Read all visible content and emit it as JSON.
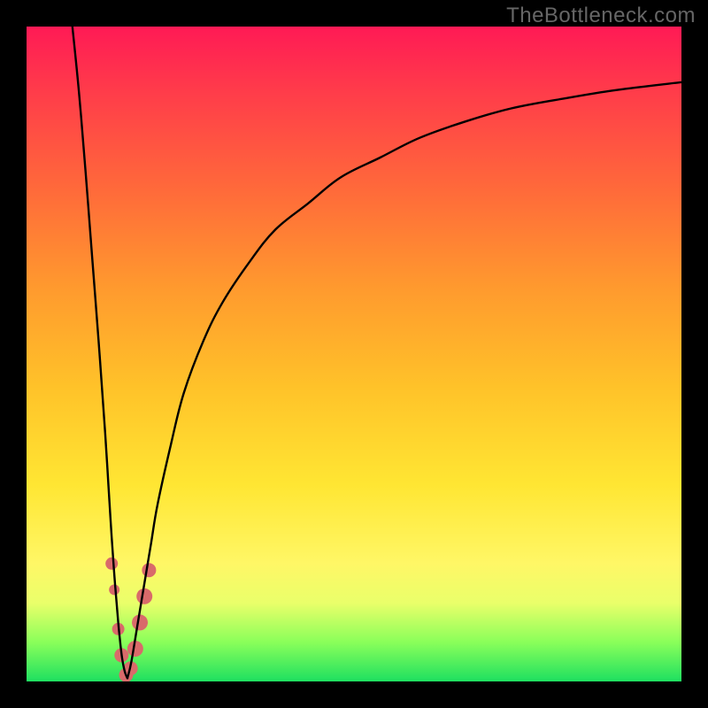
{
  "watermark": "TheBottleneck.com",
  "chart_data": {
    "type": "line",
    "title": "",
    "xlabel": "",
    "ylabel": "",
    "xlim": [
      0,
      100
    ],
    "ylim": [
      0,
      100
    ],
    "series": [
      {
        "name": "left-branch",
        "x": [
          7,
          8,
          9,
          10,
          11,
          12,
          12.5,
          13,
          13.5,
          14,
          14.3,
          14.6,
          15,
          15.4
        ],
        "y": [
          100,
          90,
          78,
          65,
          52,
          38,
          30,
          22,
          15,
          9,
          6,
          3.5,
          1.5,
          0.5
        ]
      },
      {
        "name": "right-branch",
        "x": [
          15.4,
          16,
          17,
          18,
          19,
          20,
          22,
          24,
          27,
          30,
          34,
          38,
          43,
          48,
          54,
          60,
          67,
          74,
          82,
          90,
          100
        ],
        "y": [
          0.5,
          3,
          9,
          15,
          21,
          27,
          36,
          44,
          52,
          58,
          64,
          69,
          73,
          77,
          80,
          83,
          85.5,
          87.5,
          89,
          90.3,
          91.5
        ]
      }
    ],
    "markers": {
      "name": "highlight-dots",
      "color": "#d96a6a",
      "points": [
        {
          "x": 13.0,
          "y": 18,
          "r": 7
        },
        {
          "x": 13.4,
          "y": 14,
          "r": 6
        },
        {
          "x": 14.0,
          "y": 8,
          "r": 7
        },
        {
          "x": 14.5,
          "y": 4,
          "r": 8
        },
        {
          "x": 15.2,
          "y": 1,
          "r": 8
        },
        {
          "x": 15.9,
          "y": 2,
          "r": 8
        },
        {
          "x": 16.6,
          "y": 5,
          "r": 9
        },
        {
          "x": 17.3,
          "y": 9,
          "r": 9
        },
        {
          "x": 18.0,
          "y": 13,
          "r": 9
        },
        {
          "x": 18.7,
          "y": 17,
          "r": 8
        }
      ]
    }
  }
}
